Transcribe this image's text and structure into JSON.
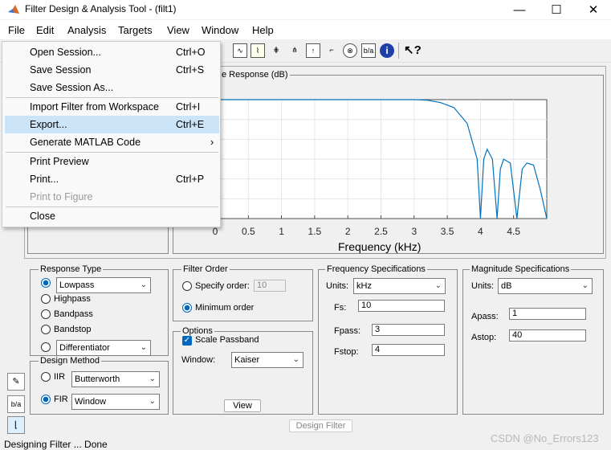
{
  "window": {
    "title": "Filter Design & Analysis Tool -  (filt1)",
    "minimize_icon": "minimize-icon",
    "maximize_icon": "maximize-icon",
    "close_icon": "close-icon"
  },
  "menubar": {
    "file": "File",
    "edit": "Edit",
    "analysis": "Analysis",
    "targets": "Targets",
    "view": "View",
    "window": "Window",
    "help": "Help"
  },
  "file_menu": [
    {
      "label": "Open Session...",
      "shortcut": "Ctrl+O"
    },
    {
      "label": "Save Session",
      "shortcut": "Ctrl+S"
    },
    {
      "label": "Save Session As...",
      "shortcut": ""
    },
    {
      "label": "Import Filter from Workspace",
      "shortcut": "Ctrl+I"
    },
    {
      "label": "Export...",
      "shortcut": "Ctrl+E"
    },
    {
      "label": "Generate MATLAB Code",
      "shortcut": "›"
    },
    {
      "label": "Print Preview",
      "shortcut": ""
    },
    {
      "label": "Print...",
      "shortcut": "Ctrl+P"
    },
    {
      "label": "Print to Figure",
      "shortcut": ""
    },
    {
      "label": "Close",
      "shortcut": ""
    }
  ],
  "plot": {
    "panel_title": "e Response (dB)",
    "xlabel": "Frequency (kHz)"
  },
  "chart_data": {
    "type": "line",
    "title": "",
    "xlabel": "Frequency (kHz)",
    "ylabel": "",
    "xlim": [
      0,
      5
    ],
    "x_ticks": [
      "0",
      "0.5",
      "1",
      "1.5",
      "2",
      "2.5",
      "3",
      "3.5",
      "4",
      "4.5"
    ],
    "grid": true,
    "color": "#0072bd",
    "series": [
      {
        "x": [
          0,
          3.0,
          3.2,
          3.4,
          3.6,
          3.8,
          3.95,
          4.0,
          4.05,
          4.1,
          4.18,
          4.25,
          4.3,
          4.35,
          4.45,
          4.55,
          4.63,
          4.7,
          4.8,
          4.9,
          5.0
        ],
        "y": [
          0,
          0,
          -0.3,
          -1.5,
          -4,
          -12,
          -30,
          -60,
          -30,
          -25,
          -30,
          -60,
          -35,
          -30,
          -32,
          -60,
          -35,
          -32,
          -33,
          -45,
          -60
        ]
      }
    ]
  },
  "response_type": {
    "title": "Response Type",
    "lowpass": "Lowpass",
    "highpass": "Highpass",
    "bandpass": "Bandpass",
    "bandstop": "Bandstop",
    "differentiator": "Differentiator"
  },
  "design_method": {
    "title": "Design Method",
    "iir": "IIR",
    "iir_value": "Butterworth",
    "fir": "FIR",
    "fir_value": "Window"
  },
  "filter_order": {
    "title": "Filter Order",
    "specify": "Specify order:",
    "specify_value": "10",
    "minimum": "Minimum order"
  },
  "options": {
    "title": "Options",
    "scale_passband": "Scale Passband",
    "window_label": "Window:",
    "window_value": "Kaiser",
    "view": "View"
  },
  "freq_specs": {
    "title": "Frequency Specifications",
    "units_label": "Units:",
    "units_value": "kHz",
    "fs_label": "Fs:",
    "fs": "10",
    "fpass_label": "Fpass:",
    "fpass": "3",
    "fstop_label": "Fstop:",
    "fstop": "4"
  },
  "mag_specs": {
    "title": "Magnitude Specifications",
    "units_label": "Units:",
    "units_value": "dB",
    "apass_label": "Apass:",
    "apass": "1",
    "astop_label": "Astop:",
    "astop": "40"
  },
  "design_filter": "Design Filter",
  "status": "Designing Filter ... Done",
  "watermark": "CSDN @No_Errors123"
}
